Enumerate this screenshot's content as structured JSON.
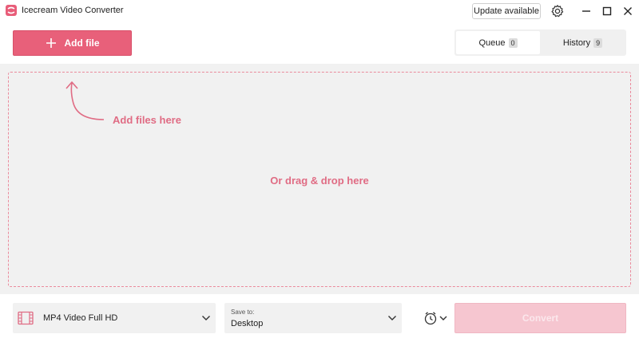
{
  "app": {
    "title": "Icecream Video Converter"
  },
  "titlebar": {
    "update_label": "Update available"
  },
  "toolbar": {
    "add_file_label": "Add file"
  },
  "tabs": [
    {
      "label": "Queue",
      "count": "0",
      "active": true
    },
    {
      "label": "History",
      "count": "9",
      "active": false
    }
  ],
  "dropzone": {
    "add_hint": "Add files here",
    "drag_hint": "Or drag & drop here"
  },
  "bottom": {
    "format_value": "MP4 Video Full HD",
    "save_caption": "Save to:",
    "save_value": "Desktop",
    "convert_label": "Convert"
  },
  "colors": {
    "accent": "#e8607a",
    "accent_disabled": "#f6c6d0",
    "hint_text": "#e06c84",
    "panel_bg": "#f1f1f1"
  },
  "icons": [
    "app-logo-icon",
    "gear-icon",
    "minimize-icon",
    "maximize-icon",
    "close-icon",
    "plus-icon",
    "curved-arrow-icon",
    "video-format-icon",
    "chevron-down-icon",
    "alarm-clock-icon"
  ]
}
